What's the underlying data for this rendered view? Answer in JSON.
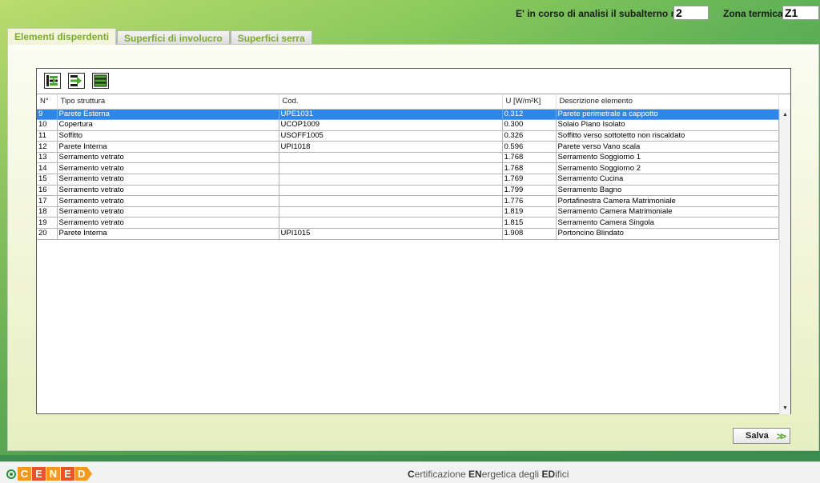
{
  "header": {
    "subalterno_label": "E' in corso di analisi il subalterno n°",
    "subalterno_value": "2",
    "zona_label": "Zona termica",
    "zona_value": "Z1"
  },
  "tabs": [
    {
      "label": "Elementi disperdenti",
      "active": true
    },
    {
      "label": "Superfici di involucro",
      "active": false
    },
    {
      "label": "Superfici serra",
      "active": false
    }
  ],
  "toolbar": {
    "icons": [
      "insert-element-icon",
      "move-element-icon",
      "list-view-icon"
    ]
  },
  "table": {
    "columns": [
      "N°",
      "Tipo struttura",
      "Cod.",
      "U [W/m²K]",
      "Descrizione elemento"
    ],
    "selected_row": 0,
    "rows": [
      [
        "9",
        "Parete Esterna",
        "UPE1031",
        "0.312",
        "Parete perimetrale a cappotto"
      ],
      [
        "10",
        "Copertura",
        "UCOP1009",
        "0.300",
        "Solaio Piano Isolato"
      ],
      [
        "11",
        "Soffitto",
        "USOFF1005",
        "0.326",
        "Soffitto verso sottotetto non riscaldato"
      ],
      [
        "12",
        "Parete Interna",
        "UPI1018",
        "0.596",
        "Parete verso Vano scala"
      ],
      [
        "13",
        "Serramento vetrato",
        "",
        "1.768",
        "Serramento Soggiorno 1"
      ],
      [
        "14",
        "Serramento vetrato",
        "",
        "1.768",
        "Serramento Soggiorno 2"
      ],
      [
        "15",
        "Serramento vetrato",
        "",
        "1.769",
        "Serramento Cucina"
      ],
      [
        "16",
        "Serramento vetrato",
        "",
        "1.799",
        "Serramento Bagno"
      ],
      [
        "17",
        "Serramento vetrato",
        "",
        "1.776",
        "Portafinestra Camera Matrimoniale"
      ],
      [
        "18",
        "Serramento vetrato",
        "",
        "1.819",
        "Serramento Camera Matrimoniale"
      ],
      [
        "19",
        "Serramento vetrato",
        "",
        "1.815",
        "Serramento Camera Singola"
      ],
      [
        "20",
        "Parete Interna",
        "UPI1015",
        "1.908",
        "Portoncino Blindato"
      ]
    ]
  },
  "actions": {
    "save_label": "Salva"
  },
  "footer": {
    "logo_letters": [
      "C",
      "E",
      "N",
      "E",
      "D"
    ],
    "logo_colors": [
      "#f39a1e",
      "#e5542a",
      "#f39a1e",
      "#e5542a",
      "#f39a1e"
    ],
    "tagline_parts": [
      {
        "text": "C",
        "bold": true
      },
      {
        "text": "ertificazione ",
        "bold": false
      },
      {
        "text": "EN",
        "bold": true
      },
      {
        "text": "ergetica degli ",
        "bold": false
      },
      {
        "text": "ED",
        "bold": true
      },
      {
        "text": "ifici",
        "bold": false
      }
    ]
  },
  "colors": {
    "selection": "#2f86e8",
    "tab_text": "#7cab2b",
    "accent_green": "#3d8d4e"
  }
}
